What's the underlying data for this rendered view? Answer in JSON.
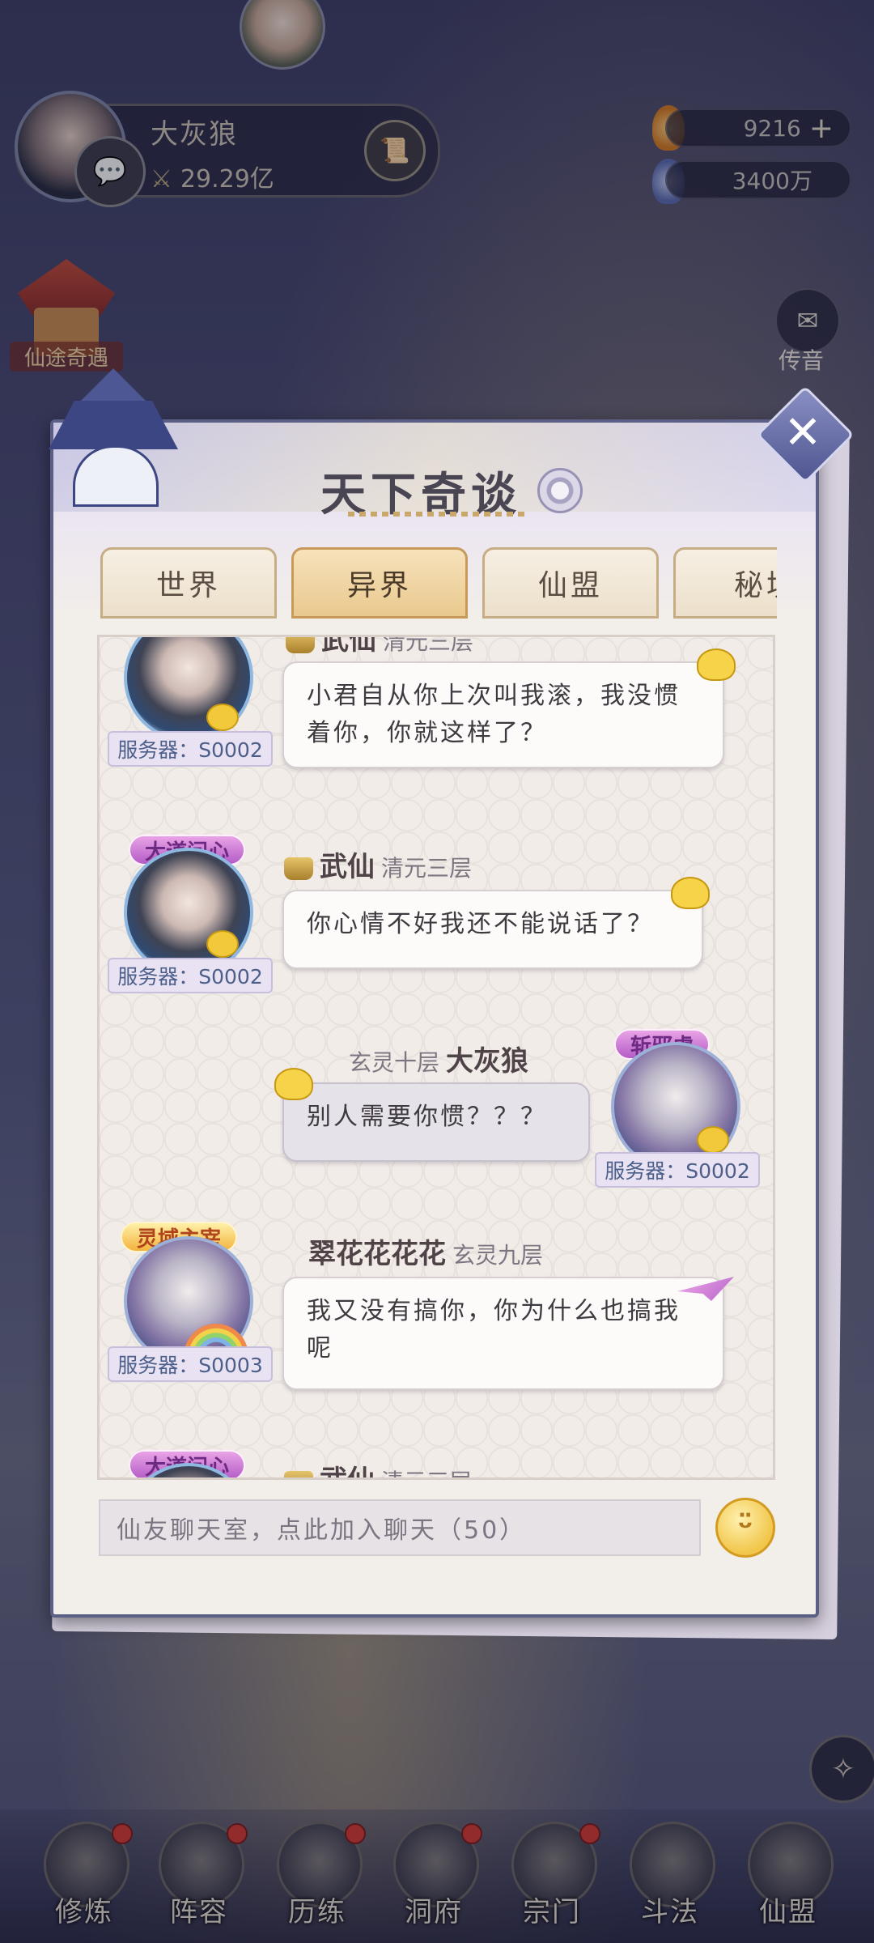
{
  "player": {
    "name": "大灰狼",
    "power": "29.29亿"
  },
  "currency": {
    "gold": "9216",
    "spirit": "3400万",
    "plus": "+"
  },
  "left_event": {
    "label": "仙途奇遇"
  },
  "right_side": {
    "mail_label": "传音"
  },
  "dialog": {
    "title": "天下奇谈",
    "close": "✕",
    "tabs": [
      {
        "label": "世界"
      },
      {
        "label": "异界"
      },
      {
        "label": "仙盟"
      },
      {
        "label": "秘境"
      }
    ],
    "active_tab": "异界"
  },
  "messages": [
    {
      "name": "武仙",
      "rank": "清元三层",
      "server": "服务器：S0002",
      "text": "小君自从你上次叫我滚，我没惯着你，你就这样了？"
    },
    {
      "badge": "大道问心",
      "name": "武仙",
      "rank": "清元三层",
      "server": "服务器：S0002",
      "text": "你心情不好我还不能说话了？"
    },
    {
      "badge": "斩邪虚",
      "name": "大灰狼",
      "rank": "玄灵十层",
      "server": "服务器：S0002",
      "text": "别人需要你惯？？？"
    },
    {
      "badge": "灵域主宰",
      "name": "翠花花花花",
      "rank": "玄灵九层",
      "server": "服务器：S0003",
      "text": "我又没有搞你，你为什么也搞我呢"
    },
    {
      "badge": "大道问心",
      "name": "武仙",
      "rank": "清元三层"
    }
  ],
  "input": {
    "placeholder": "仙友聊天室，点此加入聊天（50）"
  },
  "bottom_nav": [
    {
      "label": "修炼"
    },
    {
      "label": "阵容"
    },
    {
      "label": "历练"
    },
    {
      "label": "洞府"
    },
    {
      "label": "宗门"
    },
    {
      "label": "斗法"
    },
    {
      "label": "仙盟"
    }
  ],
  "icons": {
    "chat": "chat-bubble-icon",
    "scroll": "scroll-icon",
    "mail": "mail-icon",
    "settings": "settings-gear-icon",
    "close": "close-icon",
    "emoji": "emoji-icon",
    "compass": "compass-icon"
  },
  "colors": {
    "active_tab": "#e9c98e",
    "panel_bg": "#f2eeea",
    "server_text": "#4c5f8a"
  }
}
